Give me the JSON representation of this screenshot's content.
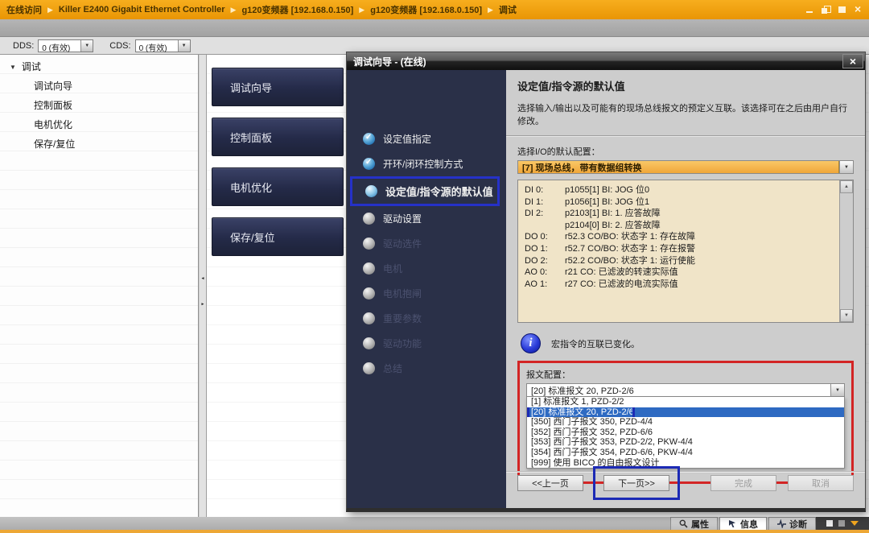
{
  "window": {
    "breadcrumb": [
      "在线访问",
      "Killer E2400 Gigabit Ethernet Controller",
      "g120变频器 [192.168.0.150]",
      "g120变频器 [192.168.0.150]",
      "调试"
    ],
    "separator": "▶"
  },
  "toolbar": {
    "dds_label": "DDS:",
    "dds_value": "0 (有效)",
    "cds_label": "CDS:",
    "cds_value": "0 (有效)"
  },
  "sidebar": {
    "root": "调试",
    "items": [
      "调试向导",
      "控制面板",
      "电机优化",
      "保存/复位"
    ]
  },
  "nav_buttons": [
    "调试向导",
    "控制面板",
    "电机优化",
    "保存/复位"
  ],
  "dialog": {
    "title": "调试向导 - (在线)",
    "steps": [
      {
        "label": "设定值指定",
        "state": "done"
      },
      {
        "label": "开环/闭环控制方式",
        "state": "done"
      },
      {
        "label": "设定值/指令源的默认值",
        "state": "current"
      },
      {
        "label": "驱动设置",
        "state": "next"
      },
      {
        "label": "驱动选件",
        "state": "pending"
      },
      {
        "label": "电机",
        "state": "pending"
      },
      {
        "label": "电机抱闸",
        "state": "pending"
      },
      {
        "label": "重要参数",
        "state": "pending"
      },
      {
        "label": "驱动功能",
        "state": "pending"
      },
      {
        "label": "总结",
        "state": "pending"
      }
    ],
    "content": {
      "heading": "设定值/指令源的默认值",
      "description": "选择输入/输出以及可能有的现场总线报文的预定义互联。该选择可在之后由用户自行修改。",
      "io_label": "选择I/O的默认配置：",
      "io_value": "[7] 现场总线，带有数据组转换",
      "io_list": [
        {
          "port": "DI 0:",
          "text": "p1055[1] BI: JOG 位0"
        },
        {
          "port": "DI 1:",
          "text": "p1056[1] BI: JOG 位1"
        },
        {
          "port": "DI 2:",
          "text": "p2103[1] BI: 1. 应答故障"
        },
        {
          "port": "",
          "text": "p2104[0] BI: 2. 应答故障"
        },
        {
          "port": "",
          "text": ""
        },
        {
          "port": "DO 0:",
          "text": "r52.3 CO/BO: 状态字 1: 存在故障"
        },
        {
          "port": "DO 1:",
          "text": "r52.7 CO/BO: 状态字 1: 存在报警"
        },
        {
          "port": "DO 2:",
          "text": "r52.2 CO/BO: 状态字 1: 运行使能"
        },
        {
          "port": "",
          "text": ""
        },
        {
          "port": "AO 0:",
          "text": "r21 CO: 已滤波的转速实际值"
        },
        {
          "port": "AO 1:",
          "text": "r27 CO: 已滤波的电流实际值"
        }
      ],
      "info_text": "宏指令的互联已变化。",
      "telegram_label": "报文配置：",
      "telegram_value": "[20] 标准报文 20, PZD-2/6",
      "telegram_options": [
        {
          "label": "[1] 标准报文 1, PZD-2/2",
          "selected": false
        },
        {
          "label": "[20] 标准报文 20, PZD-2/6",
          "selected": true
        },
        {
          "label": "[350] 西门子报文 350, PZD-4/4",
          "selected": false
        },
        {
          "label": "[352] 西门子报文 352, PZD-6/6",
          "selected": false
        },
        {
          "label": "[353] 西门子报文 353, PZD-2/2, PKW-4/4",
          "selected": false
        },
        {
          "label": "[354] 西门子报文 354, PZD-6/6, PKW-4/4",
          "selected": false
        },
        {
          "label": "[999] 使用 BICO 的自由报文设计",
          "selected": false
        }
      ],
      "buttons": {
        "prev": "<<上一页",
        "next": "下一页>>",
        "finish": "完成",
        "cancel": "取消"
      }
    }
  },
  "statusbar": {
    "tabs": [
      "属性",
      "信息",
      "诊断"
    ]
  },
  "colors": {
    "titlebar_orange": "#f0a112",
    "wizard_navy": "#2a3048",
    "combo_orange": "#f5b54f",
    "listbox_beige": "#f0e4c8",
    "selection_blue": "#2e6ac2",
    "annotation_red": "#d32525",
    "annotation_blue": "#1c2ab5"
  }
}
